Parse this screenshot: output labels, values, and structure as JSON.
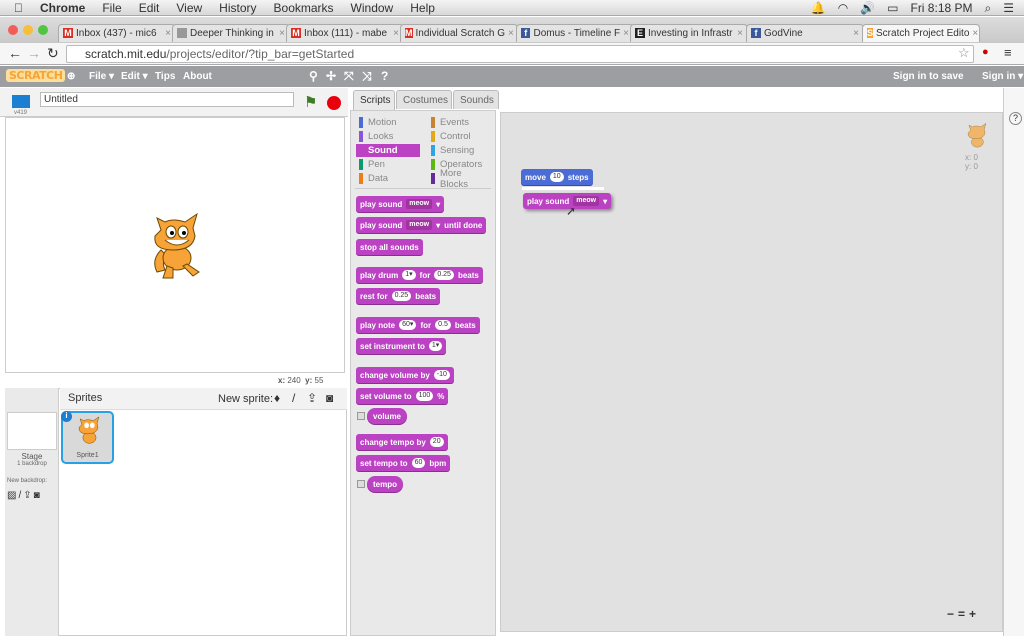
{
  "macbar": {
    "menus": [
      "Chrome",
      "File",
      "Edit",
      "View",
      "History",
      "Bookmarks",
      "Window",
      "Help"
    ],
    "clock": "Fri 8:18 PM"
  },
  "tabs": [
    {
      "icon": "gmail-icon",
      "label": "Inbox (437) - mic6",
      "color": "#d93025",
      "glyph": "M"
    },
    {
      "icon": "page-icon",
      "label": "Deeper Thinking in",
      "color": "#999",
      "glyph": ""
    },
    {
      "icon": "gmail-icon",
      "label": "Inbox (111) - mabe",
      "color": "#d93025",
      "glyph": "M"
    },
    {
      "icon": "gmail-icon",
      "label": "Individual Scratch G",
      "color": "#d93025",
      "glyph": "M"
    },
    {
      "icon": "facebook-icon",
      "label": "Domus - Timeline F",
      "color": "#3b5998",
      "glyph": "f"
    },
    {
      "icon": "e-icon",
      "label": "Investing in Infrastr",
      "color": "#222",
      "glyph": "E"
    },
    {
      "icon": "facebook-icon",
      "label": "GodVine",
      "color": "#3b5998",
      "glyph": "f"
    },
    {
      "icon": "scratch-icon",
      "label": "Scratch Project Edito",
      "color": "#f7a337",
      "glyph": "S",
      "active": true
    }
  ],
  "address": {
    "host": "scratch.mit.edu",
    "path": "/projects/editor/?tip_bar=getStarted"
  },
  "scratch_menu": {
    "logo": "SCRATCH",
    "file": "File ▾",
    "edit": "Edit ▾",
    "tips": "Tips",
    "about": "About",
    "sign_in_save": "Sign in to save",
    "sign_in": "Sign in ▾"
  },
  "stage": {
    "version": "v419",
    "title": "Untitled",
    "x_label": "x:",
    "x": "240",
    "y_label": "y:",
    "y": "55"
  },
  "sprites": {
    "header": "Sprites",
    "new_sprite": "New sprite:",
    "sprite_name": "Sprite1",
    "stage_label": "Stage",
    "backdrops": "1 backdrop",
    "new_backdrop": "New backdrop:"
  },
  "palette": {
    "tabs": [
      "Scripts",
      "Costumes",
      "Sounds"
    ],
    "categories": [
      {
        "label": "Motion",
        "color": "#4a6cd4"
      },
      {
        "label": "Events",
        "color": "#c88330"
      },
      {
        "label": "Looks",
        "color": "#8a55d7"
      },
      {
        "label": "Control",
        "color": "#e1a91a"
      },
      {
        "label": "Sound",
        "color": "#bb42c3",
        "selected": true
      },
      {
        "label": "Sensing",
        "color": "#2ca5e2"
      },
      {
        "label": "Pen",
        "color": "#0e9a6c"
      },
      {
        "label": "Operators",
        "color": "#5cb712"
      },
      {
        "label": "Data",
        "color": "#ee7d16"
      },
      {
        "label": "More Blocks",
        "color": "#632d99"
      }
    ],
    "blocks": [
      {
        "parts": [
          [
            "t",
            "play sound"
          ],
          [
            "d",
            "meow"
          ]
        ]
      },
      {
        "parts": [
          [
            "t",
            "play sound"
          ],
          [
            "d",
            "meow"
          ],
          [
            "t",
            "until done"
          ]
        ]
      },
      {
        "parts": [
          [
            "t",
            "stop all sounds"
          ]
        ]
      },
      {
        "parts": [
          [
            "t",
            "play drum"
          ],
          [
            "i",
            "1▾"
          ],
          [
            "t",
            "for"
          ],
          [
            "i",
            "0.25"
          ],
          [
            "t",
            "beats"
          ]
        ]
      },
      {
        "parts": [
          [
            "t",
            "rest for"
          ],
          [
            "i",
            "0.25"
          ],
          [
            "t",
            "beats"
          ]
        ]
      },
      {
        "parts": [
          [
            "t",
            "play note"
          ],
          [
            "i",
            "60▾"
          ],
          [
            "t",
            "for"
          ],
          [
            "i",
            "0.5"
          ],
          [
            "t",
            "beats"
          ]
        ]
      },
      {
        "parts": [
          [
            "t",
            "set instrument to"
          ],
          [
            "i",
            "1▾"
          ]
        ]
      },
      {
        "parts": [
          [
            "t",
            "change volume by"
          ],
          [
            "i",
            "-10"
          ]
        ]
      },
      {
        "parts": [
          [
            "t",
            "set volume to"
          ],
          [
            "i",
            "100"
          ],
          [
            "t",
            "%"
          ]
        ]
      },
      {
        "parts": [
          [
            "t",
            "volume"
          ]
        ],
        "reporter": true
      },
      {
        "parts": [
          [
            "t",
            "change tempo by"
          ],
          [
            "i",
            "20"
          ]
        ]
      },
      {
        "parts": [
          [
            "t",
            "set tempo to"
          ],
          [
            "i",
            "60"
          ],
          [
            "t",
            "bpm"
          ]
        ]
      },
      {
        "parts": [
          [
            "t",
            "tempo"
          ]
        ],
        "reporter": true
      }
    ]
  },
  "scripts": {
    "move": {
      "parts": [
        [
          "t",
          "move"
        ],
        [
          "i",
          "10"
        ],
        [
          "t",
          "steps"
        ]
      ],
      "color": "#4a6cd4"
    },
    "play": {
      "parts": [
        [
          "t",
          "play sound"
        ],
        [
          "d",
          "meow"
        ]
      ]
    },
    "sprite_x": "x: 0",
    "sprite_y": "y: 0",
    "zoom": [
      "−",
      "=",
      "+"
    ]
  }
}
